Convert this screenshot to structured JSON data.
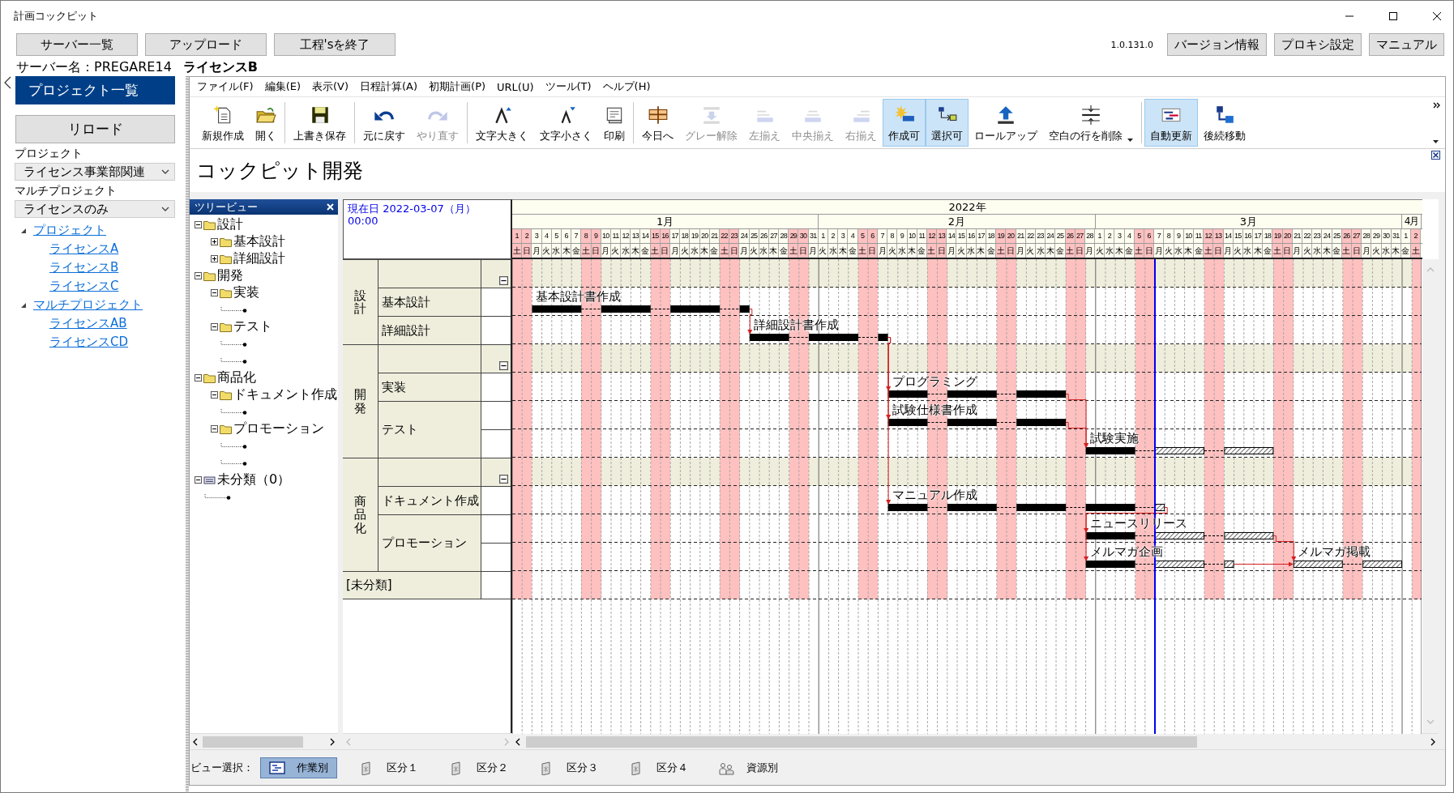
{
  "window": {
    "title": "計画コックピット"
  },
  "top_buttons": [
    "サーバー一覧",
    "アップロード",
    "工程'sを終了"
  ],
  "version": "1.0.131.0",
  "right_buttons": [
    "バージョン情報",
    "プロキシ設定",
    "マニュアル"
  ],
  "server": {
    "label": "サーバー名：PREGARE14",
    "license": "ライセンスB"
  },
  "sidebar": {
    "header": "プロジェクト一覧",
    "reload": "リロード",
    "project_label": "プロジェクト",
    "project_value": "ライセンス事業部関連",
    "multi_label": "マルチプロジェクト",
    "multi_value": "ライセンスのみ",
    "tree": [
      {
        "label": "プロジェクト",
        "expanded": true,
        "children": [
          {
            "label": "ライセンスA"
          },
          {
            "label": "ライセンスB"
          },
          {
            "label": "ライセンスC"
          }
        ]
      },
      {
        "label": "マルチプロジェクト",
        "expanded": true,
        "children": [
          {
            "label": "ライセンスAB"
          },
          {
            "label": "ライセンスCD"
          }
        ]
      }
    ]
  },
  "menu": [
    "ファイル(F)",
    "編集(E)",
    "表示(V)",
    "日程計算(A)",
    "初期計画(P)",
    "URL(U)",
    "ツール(T)",
    "ヘルプ(H)"
  ],
  "toolbar": [
    {
      "kind": "button",
      "label": "新規作成",
      "disabled": false,
      "on": false,
      "menu": false
    },
    {
      "kind": "button",
      "label": "開く",
      "disabled": false,
      "on": false,
      "menu": false
    },
    {
      "kind": "separator"
    },
    {
      "kind": "button",
      "label": "上書き保存",
      "disabled": false,
      "on": false,
      "menu": false
    },
    {
      "kind": "separator"
    },
    {
      "kind": "button",
      "label": "元に戻す",
      "disabled": false,
      "on": false,
      "menu": false
    },
    {
      "kind": "button",
      "label": "やり直す",
      "disabled": true,
      "on": false,
      "menu": false
    },
    {
      "kind": "separator"
    },
    {
      "kind": "button",
      "label": "文字大きく",
      "disabled": false,
      "on": false,
      "menu": false
    },
    {
      "kind": "button",
      "label": "文字小さく",
      "disabled": false,
      "on": false,
      "menu": false
    },
    {
      "kind": "button",
      "label": "印刷",
      "disabled": false,
      "on": false,
      "menu": false
    },
    {
      "kind": "separator"
    },
    {
      "kind": "button",
      "label": "今日へ",
      "disabled": false,
      "on": false,
      "menu": false
    },
    {
      "kind": "button",
      "label": "グレー解除",
      "disabled": true,
      "on": false,
      "menu": false
    },
    {
      "kind": "button",
      "label": "左揃え",
      "disabled": true,
      "on": false,
      "menu": false
    },
    {
      "kind": "button",
      "label": "中央揃え",
      "disabled": true,
      "on": false,
      "menu": false
    },
    {
      "kind": "button",
      "label": "右揃え",
      "disabled": true,
      "on": false,
      "menu": false
    },
    {
      "kind": "button",
      "label": "作成可",
      "disabled": false,
      "on": true,
      "menu": false
    },
    {
      "kind": "button",
      "label": "選択可",
      "disabled": false,
      "on": true,
      "menu": false
    },
    {
      "kind": "button",
      "label": "ロールアップ",
      "disabled": false,
      "on": false,
      "menu": false
    },
    {
      "kind": "button",
      "label": "空白の行を削除",
      "disabled": false,
      "on": false,
      "menu": true
    },
    {
      "kind": "separator"
    },
    {
      "kind": "button",
      "label": "自動更新",
      "disabled": false,
      "on": true,
      "menu": false
    },
    {
      "kind": "button",
      "label": "後続移動",
      "disabled": false,
      "on": false,
      "menu": false
    }
  ],
  "document_title": "コックピット開発",
  "tree_view": {
    "title": "ツリービュー",
    "items": [
      {
        "kind": "folder",
        "label": "設計",
        "expanded": true,
        "children": [
          {
            "kind": "folder",
            "label": "基本設計",
            "expanded": false
          },
          {
            "kind": "folder",
            "label": "詳細設計",
            "expanded": false
          }
        ]
      },
      {
        "kind": "folder",
        "label": "開発",
        "expanded": true,
        "children": [
          {
            "kind": "folder",
            "label": "実装",
            "expanded": true,
            "children": [
              {
                "kind": "leaf"
              }
            ]
          },
          {
            "kind": "folder",
            "label": "テスト",
            "expanded": true,
            "children": [
              {
                "kind": "leaf"
              },
              {
                "kind": "leaf"
              }
            ]
          }
        ]
      },
      {
        "kind": "folder",
        "label": "商品化",
        "expanded": true,
        "children": [
          {
            "kind": "folder",
            "label": "ドキュメント作成",
            "expanded": true,
            "children": [
              {
                "kind": "leaf"
              }
            ]
          },
          {
            "kind": "folder",
            "label": "プロモーション",
            "expanded": true,
            "children": [
              {
                "kind": "leaf"
              },
              {
                "kind": "leaf"
              }
            ]
          }
        ]
      },
      {
        "kind": "list",
        "label": "未分類（0）",
        "expanded": true,
        "children": [
          {
            "kind": "leaf"
          }
        ]
      }
    ]
  },
  "gantt": {
    "current_date": "現在日 2022-03-07（月）",
    "current_time": "00:00",
    "year": "2022年",
    "months": [
      {
        "label": "1月",
        "days": [
          {
            "day": "1",
            "weekday": "土",
            "off": true
          },
          {
            "day": "2",
            "weekday": "日",
            "off": true
          },
          {
            "day": "3",
            "weekday": "月",
            "off": false
          },
          {
            "day": "4",
            "weekday": "火",
            "off": false
          },
          {
            "day": "5",
            "weekday": "水",
            "off": false
          },
          {
            "day": "6",
            "weekday": "木",
            "off": false
          },
          {
            "day": "7",
            "weekday": "金",
            "off": false
          },
          {
            "day": "8",
            "weekday": "土",
            "off": true
          },
          {
            "day": "9",
            "weekday": "日",
            "off": true
          },
          {
            "day": "10",
            "weekday": "月",
            "off": false
          },
          {
            "day": "11",
            "weekday": "火",
            "off": false
          },
          {
            "day": "12",
            "weekday": "水",
            "off": false
          },
          {
            "day": "13",
            "weekday": "木",
            "off": false
          },
          {
            "day": "14",
            "weekday": "金",
            "off": false
          },
          {
            "day": "15",
            "weekday": "土",
            "off": true
          },
          {
            "day": "16",
            "weekday": "日",
            "off": true
          },
          {
            "day": "17",
            "weekday": "月",
            "off": false
          },
          {
            "day": "18",
            "weekday": "火",
            "off": false
          },
          {
            "day": "19",
            "weekday": "水",
            "off": false
          },
          {
            "day": "20",
            "weekday": "木",
            "off": false
          },
          {
            "day": "21",
            "weekday": "金",
            "off": false
          },
          {
            "day": "22",
            "weekday": "土",
            "off": true
          },
          {
            "day": "23",
            "weekday": "日",
            "off": true
          },
          {
            "day": "24",
            "weekday": "月",
            "off": false
          },
          {
            "day": "25",
            "weekday": "火",
            "off": false
          },
          {
            "day": "26",
            "weekday": "水",
            "off": false
          },
          {
            "day": "27",
            "weekday": "木",
            "off": false
          },
          {
            "day": "28",
            "weekday": "金",
            "off": false
          },
          {
            "day": "29",
            "weekday": "土",
            "off": true
          },
          {
            "day": "30",
            "weekday": "日",
            "off": true
          },
          {
            "day": "31",
            "weekday": "月",
            "off": false
          }
        ]
      },
      {
        "label": "2月",
        "days": [
          {
            "day": "1",
            "weekday": "火",
            "off": false
          },
          {
            "day": "2",
            "weekday": "水",
            "off": false
          },
          {
            "day": "3",
            "weekday": "木",
            "off": false
          },
          {
            "day": "4",
            "weekday": "金",
            "off": false
          },
          {
            "day": "5",
            "weekday": "土",
            "off": true
          },
          {
            "day": "6",
            "weekday": "日",
            "off": true
          },
          {
            "day": "7",
            "weekday": "月",
            "off": false
          },
          {
            "day": "8",
            "weekday": "火",
            "off": false
          },
          {
            "day": "9",
            "weekday": "水",
            "off": false
          },
          {
            "day": "10",
            "weekday": "木",
            "off": false
          },
          {
            "day": "11",
            "weekday": "金",
            "off": false
          },
          {
            "day": "12",
            "weekday": "土",
            "off": true
          },
          {
            "day": "13",
            "weekday": "日",
            "off": true
          },
          {
            "day": "14",
            "weekday": "月",
            "off": false
          },
          {
            "day": "15",
            "weekday": "火",
            "off": false
          },
          {
            "day": "16",
            "weekday": "水",
            "off": false
          },
          {
            "day": "17",
            "weekday": "木",
            "off": false
          },
          {
            "day": "18",
            "weekday": "金",
            "off": false
          },
          {
            "day": "19",
            "weekday": "土",
            "off": true
          },
          {
            "day": "20",
            "weekday": "日",
            "off": true
          },
          {
            "day": "21",
            "weekday": "月",
            "off": false
          },
          {
            "day": "22",
            "weekday": "火",
            "off": false
          },
          {
            "day": "23",
            "weekday": "水",
            "off": false
          },
          {
            "day": "24",
            "weekday": "木",
            "off": false
          },
          {
            "day": "25",
            "weekday": "金",
            "off": false
          },
          {
            "day": "26",
            "weekday": "土",
            "off": true
          },
          {
            "day": "27",
            "weekday": "日",
            "off": true
          },
          {
            "day": "28",
            "weekday": "月",
            "off": false
          }
        ]
      },
      {
        "label": "3月",
        "days": [
          {
            "day": "1",
            "weekday": "火",
            "off": false
          },
          {
            "day": "2",
            "weekday": "水",
            "off": false
          },
          {
            "day": "3",
            "weekday": "木",
            "off": false
          },
          {
            "day": "4",
            "weekday": "金",
            "off": false
          },
          {
            "day": "5",
            "weekday": "土",
            "off": true
          },
          {
            "day": "6",
            "weekday": "日",
            "off": true
          },
          {
            "day": "7",
            "weekday": "月",
            "off": false
          },
          {
            "day": "8",
            "weekday": "火",
            "off": false
          },
          {
            "day": "9",
            "weekday": "水",
            "off": false
          },
          {
            "day": "10",
            "weekday": "木",
            "off": false
          },
          {
            "day": "11",
            "weekday": "金",
            "off": false
          },
          {
            "day": "12",
            "weekday": "土",
            "off": true
          },
          {
            "day": "13",
            "weekday": "日",
            "off": true
          },
          {
            "day": "14",
            "weekday": "月",
            "off": false
          },
          {
            "day": "15",
            "weekday": "火",
            "off": false
          },
          {
            "day": "16",
            "weekday": "水",
            "off": false
          },
          {
            "day": "17",
            "weekday": "木",
            "off": false
          },
          {
            "day": "18",
            "weekday": "金",
            "off": false
          },
          {
            "day": "19",
            "weekday": "土",
            "off": true
          },
          {
            "day": "20",
            "weekday": "日",
            "off": true
          },
          {
            "day": "21",
            "weekday": "月",
            "off": false
          },
          {
            "day": "22",
            "weekday": "火",
            "off": false
          },
          {
            "day": "23",
            "weekday": "水",
            "off": false
          },
          {
            "day": "24",
            "weekday": "木",
            "off": false
          },
          {
            "day": "25",
            "weekday": "金",
            "off": false
          },
          {
            "day": "26",
            "weekday": "土",
            "off": true
          },
          {
            "day": "27",
            "weekday": "日",
            "off": true
          },
          {
            "day": "28",
            "weekday": "月",
            "off": false
          },
          {
            "day": "29",
            "weekday": "火",
            "off": false
          },
          {
            "day": "30",
            "weekday": "水",
            "off": false
          },
          {
            "day": "31",
            "weekday": "木",
            "off": false
          }
        ]
      },
      {
        "label": "4月",
        "days": [
          {
            "day": "1",
            "weekday": "金",
            "off": false
          },
          {
            "day": "2",
            "weekday": "土",
            "off": true
          }
        ]
      }
    ],
    "groups": [
      {
        "label": "設計",
        "expanded": true,
        "rows": [
          {
            "label": "基本設計",
            "lanes": [
              {
                "tasks": [
                  {
                    "name": "基本設計書作成",
                    "started": true,
                    "finished": true
                  }
                ]
              }
            ]
          },
          {
            "label": "詳細設計",
            "lanes": [
              {
                "tasks": [
                  {
                    "name": "詳細設計書作成",
                    "started": true,
                    "finished": true
                  }
                ]
              }
            ]
          }
        ]
      },
      {
        "label": "開発",
        "expanded": true,
        "rows": [
          {
            "label": "実装",
            "lanes": [
              {
                "tasks": [
                  {
                    "name": "プログラミング",
                    "started": true,
                    "finished": true
                  }
                ]
              }
            ]
          },
          {
            "label": "テスト",
            "lanes": [
              {
                "tasks": [
                  {
                    "name": "試験仕様書作成",
                    "started": true,
                    "finished": true
                  }
                ]
              },
              {
                "tasks": [
                  {
                    "name": "試験実施",
                    "started": true,
                    "finished": false
                  }
                ]
              }
            ]
          }
        ]
      },
      {
        "label": "商品化",
        "expanded": true,
        "rows": [
          {
            "label": "ドキュメント作成",
            "lanes": [
              {
                "tasks": [
                  {
                    "name": "マニュアル作成",
                    "started": true,
                    "finished": false
                  }
                ]
              }
            ]
          },
          {
            "label": "プロモーション",
            "lanes": [
              {
                "tasks": [
                  {
                    "name": "ニュースリリース",
                    "started": true,
                    "finished": false
                  }
                ]
              },
              {
                "tasks": [
                  {
                    "name": "メルマガ企画",
                    "started": true,
                    "finished": false
                  },
                  {
                    "name": "メルマガ掲載",
                    "started": false,
                    "finished": false
                  }
                ]
              }
            ]
          }
        ]
      }
    ],
    "unclassified": {
      "label": "[未分類]"
    }
  },
  "view_bar": {
    "label": "ビュー選択：",
    "tabs": [
      {
        "label": "作業別",
        "selected": true
      },
      {
        "label": "区分１",
        "selected": false
      },
      {
        "label": "区分２",
        "selected": false
      },
      {
        "label": "区分３",
        "selected": false
      },
      {
        "label": "区分４",
        "selected": false
      },
      {
        "label": "資源別",
        "selected": false
      }
    ]
  }
}
